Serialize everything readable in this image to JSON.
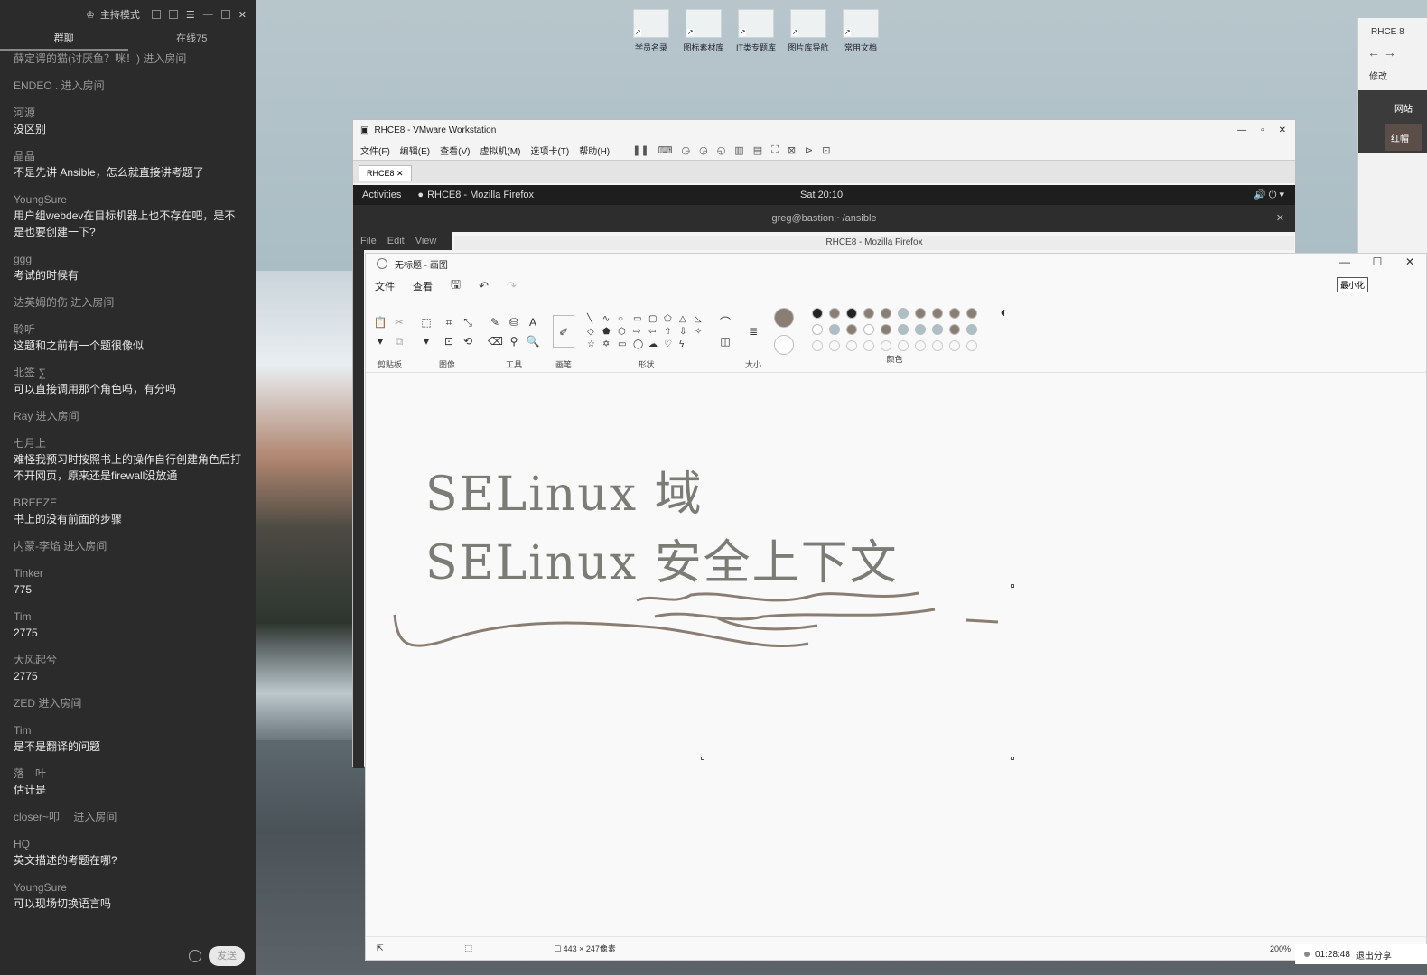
{
  "chat": {
    "header": {
      "mode": "主持模式"
    },
    "tabs": [
      "群聊",
      "在线75"
    ],
    "messages": [
      {
        "type": "sys",
        "text": "薛定谔的猫(讨厌鱼？咪！) 进入房间"
      },
      {
        "type": "sys",
        "text": "ENDEO . 进入房间"
      },
      {
        "type": "msg",
        "who": "河源",
        "text": "没区别"
      },
      {
        "type": "msg",
        "who": "晶晶",
        "text": "不是先讲 Ansible，怎么就直接讲考题了"
      },
      {
        "type": "msg",
        "who": "YoungSure",
        "text": "用户组webdev在目标机器上也不存在吧，是不是也要创建一下?"
      },
      {
        "type": "msg",
        "who": "ggg",
        "text": "考试的时候有"
      },
      {
        "type": "sys",
        "text": "达英姆的伤 进入房间"
      },
      {
        "type": "msg",
        "who": "聆听",
        "text": "这题和之前有一个题很像似"
      },
      {
        "type": "msg",
        "who": "北签 ∑",
        "text": "可以直接调用那个角色吗，有分吗"
      },
      {
        "type": "sys",
        "text": "Ray 进入房间"
      },
      {
        "type": "msg",
        "who": "七月上",
        "text": "难怪我预习时按照书上的操作自行创建角色后打不开网页，原来还是firewall没放通"
      },
      {
        "type": "msg",
        "who": "BREEZE",
        "text": "书上的没有前面的步骤"
      },
      {
        "type": "sys",
        "text": "内蒙-李焰 进入房间"
      },
      {
        "type": "msg",
        "who": "Tinker",
        "text": "775"
      },
      {
        "type": "msg",
        "who": "Tim",
        "text": "2775"
      },
      {
        "type": "msg",
        "who": "大风起兮",
        "text": "2775"
      },
      {
        "type": "sys",
        "text": "ZED 进入房间"
      },
      {
        "type": "msg",
        "who": "Tim",
        "text": "是不是翻译的问题"
      },
      {
        "type": "msg",
        "who": "落　叶",
        "text": "估计是"
      },
      {
        "type": "sys",
        "text": "closer~叩　 进入房间"
      },
      {
        "type": "msg",
        "who": "HQ",
        "text": "英文描述的考题在哪?"
      },
      {
        "type": "msg",
        "who": "YoungSure",
        "text": "可以现场切换语言吗"
      }
    ],
    "send_label": "发送"
  },
  "desktop": {
    "icons": [
      "学员名录",
      "图标素材库",
      "IT类专题库",
      "图片库导航",
      "常用文档"
    ],
    "right_browser": {
      "title": "RHCE 8",
      "bookmark": "修改",
      "dark_text": "网站",
      "button": "红帽"
    }
  },
  "vmware": {
    "title": "RHCE8 - VMware Workstation",
    "menu": [
      "文件(F)",
      "编辑(E)",
      "查看(V)",
      "虚拟机(M)",
      "选项卡(T)",
      "帮助(H)"
    ],
    "tab": "RHCE8",
    "gnome": {
      "activities": "Activities",
      "app": "RHCE8 - Mozilla Firefox",
      "clock": "Sat 20:10"
    },
    "terminal_title": "greg@bastion:~/ansible",
    "terminal_menu": [
      "File",
      "Edit",
      "View"
    ],
    "firefox_title": "RHCE8 - Mozilla Firefox"
  },
  "paint": {
    "title": "无标题 - 画图",
    "tooltip": "最小化",
    "menu": [
      "文件",
      "查看"
    ],
    "groups": [
      "剪贴板",
      "图像",
      "工具",
      "画笔",
      "形状",
      "大小",
      "颜色"
    ],
    "canvas_lines": [
      "SELinux 域",
      "SELinux 安全上下文"
    ],
    "status": {
      "dimensions": "443 × 247像素",
      "zoom": "200%"
    },
    "colors": {
      "primary": "#8a7e72",
      "palette": [
        "#222222",
        "#8a7e72",
        "#222222",
        "#8a7e72",
        "#8a7e72",
        "#a9c0c8",
        "#8a7e72",
        "#8a7e72",
        "#8a7e72",
        "#8a7e72",
        "#ffffff",
        "#a9c0c8",
        "#8a7e72",
        "#ffffff",
        "#8a7e72",
        "#a9c0c8",
        "#a9c0c8",
        "#a9c0c8",
        "#8a7e72",
        "#a9c0c8"
      ]
    }
  },
  "recorder": {
    "time": "01:28:48",
    "share": "退出分享"
  }
}
